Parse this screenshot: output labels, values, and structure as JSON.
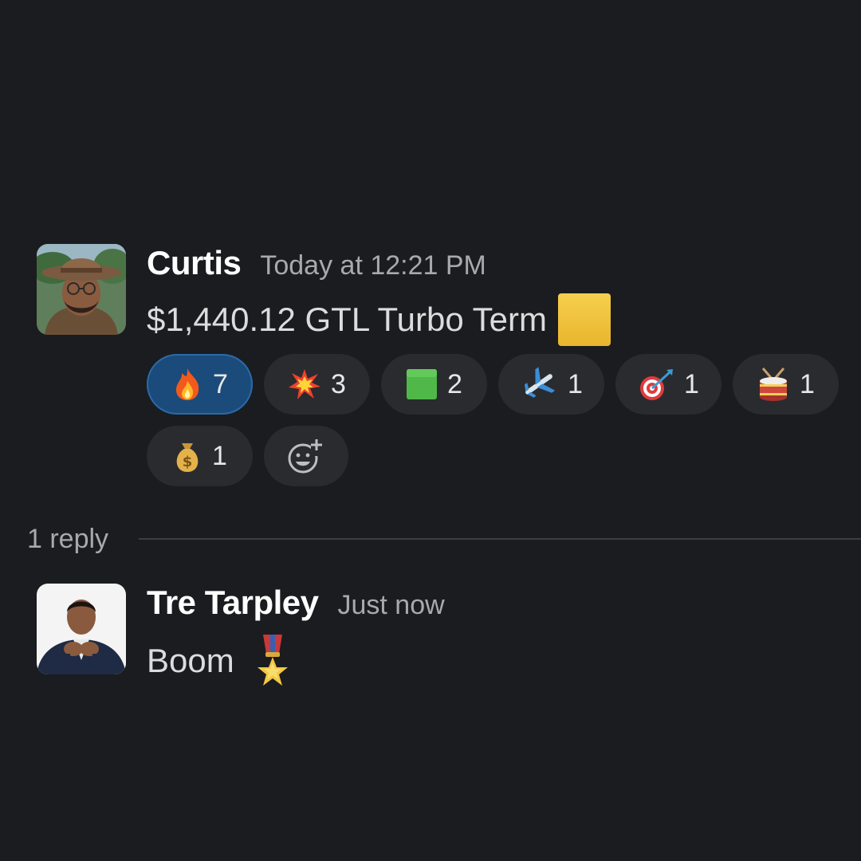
{
  "messages": [
    {
      "author": "Curtis",
      "timestamp": "Today at 12:21 PM",
      "text": "$1,440.12 GTL Turbo Term",
      "trailing_emoji": "yellow-square",
      "reactions": [
        {
          "emoji": "fire",
          "count": "7",
          "active": true
        },
        {
          "emoji": "collision",
          "count": "3",
          "active": false
        },
        {
          "emoji": "green-square",
          "count": "2",
          "active": false
        },
        {
          "emoji": "airplane",
          "count": "1",
          "active": false
        },
        {
          "emoji": "direct-hit",
          "count": "1",
          "active": false
        },
        {
          "emoji": "drum",
          "count": "1",
          "active": false
        },
        {
          "emoji": "money-bag",
          "count": "1",
          "active": false
        }
      ],
      "add_reaction_icon": "add-reaction-icon"
    },
    {
      "author": "Tre Tarpley",
      "timestamp": "Just now",
      "text": "Boom",
      "trailing_emoji": "military-medal"
    }
  ],
  "thread": {
    "replies_label": "1 reply"
  },
  "colors": {
    "background": "#1b1c1f",
    "reaction_bg": "#2a2b2f",
    "reaction_active_bg": "#1a4b7a",
    "author": "#ffffff",
    "timestamp": "#a8a9ab"
  }
}
